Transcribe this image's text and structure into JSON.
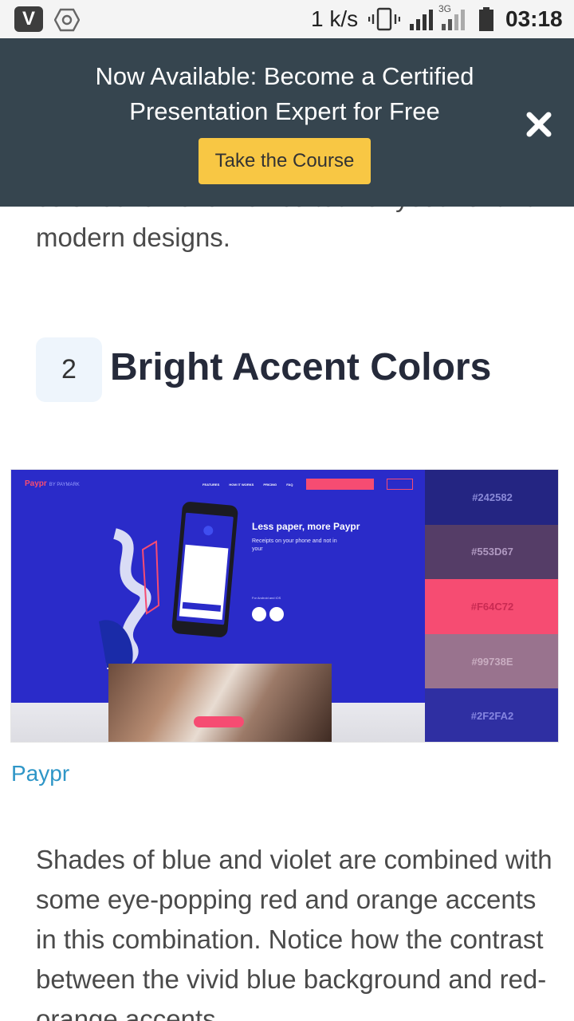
{
  "status_bar": {
    "app_letter": "V",
    "net_speed": "1 k/s",
    "network_type": "3G",
    "time": "03:18"
  },
  "promo": {
    "title": "Now Available: Become a Certified Presentation Expert for Free",
    "button_label": "Take the Course",
    "close_icon": "close-x-icon"
  },
  "article": {
    "intro_text": "color scheme is well-suited for youthful and modern designs.",
    "step_number": "2",
    "heading": "Bright Accent Colors",
    "figure": {
      "mockup": {
        "logo": "Paypr",
        "logo_sub": "BY PAYMARK",
        "nav_items": [
          "FEATURES",
          "HOW IT WORKS",
          "PRICING",
          "FAQ"
        ],
        "headline": "Less paper, more Paypr",
        "subtext": "Receipts on your phone and not in your",
        "platforms": "For Android and iOS"
      },
      "palette": [
        {
          "hex": "#242582",
          "text_color": "#8a8ad8"
        },
        {
          "hex": "#553D67",
          "text_color": "#b19ac2"
        },
        {
          "hex": "#F64C72",
          "text_color": "#c92a52"
        },
        {
          "hex": "#99738E",
          "text_color": "#c9adc1"
        },
        {
          "hex": "#2F2FA2",
          "text_color": "#8585e0"
        }
      ]
    },
    "caption": "Paypr",
    "body_text": "Shades of blue and violet are combined with some eye-popping red and orange accents in this combination. Notice how the contrast between the vivid blue background and red-orange accents"
  }
}
